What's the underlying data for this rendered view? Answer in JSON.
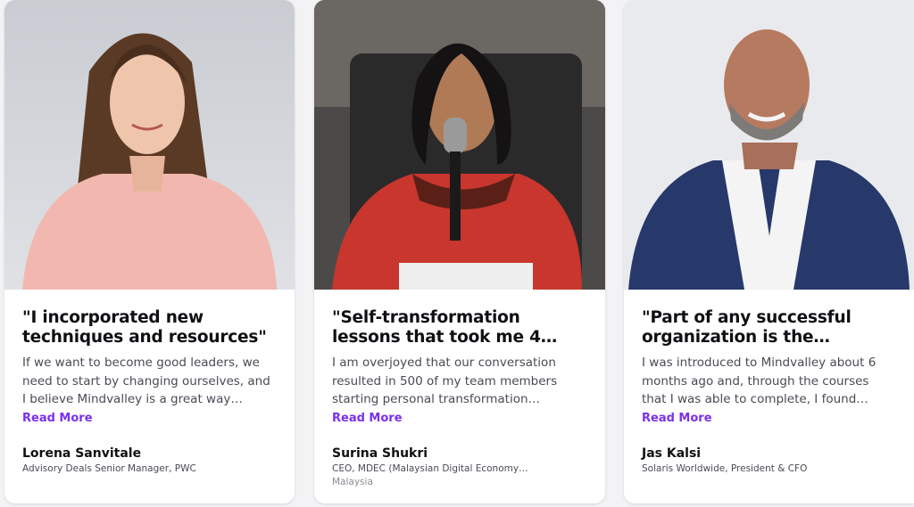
{
  "testimonials": [
    {
      "quote": "\"I incorporated new techniques and resources\"",
      "excerpt": "If we want to become good leaders, we need to start by changing ourselves, and I believe Mindvalley is a great way…",
      "read_more": "Read More",
      "author": "Lorena Sanvitale",
      "role": "Advisory Deals Senior Manager, PWC",
      "location": ""
    },
    {
      "quote": "\"Self-transformation lessons that took me 4…",
      "excerpt": "I am overjoyed that our conversation resulted in 500 of my team members starting personal transformation…",
      "read_more": "Read More",
      "author": "Surina Shukri",
      "role": "CEO, MDEC (Malaysian Digital Economy…",
      "location": "Malaysia"
    },
    {
      "quote": "\"Part of any successful organization is the…",
      "excerpt": "I was introduced to Mindvalley about 6 months ago and, through the courses that I was able to complete, I found…",
      "read_more": "Read More",
      "author": "Jas Kalsi",
      "role": "Solaris Worldwide, President & CFO",
      "location": ""
    }
  ],
  "colors": {
    "accent": "#7b2ff0",
    "text": "#101014",
    "muted": "#4a4a55"
  }
}
